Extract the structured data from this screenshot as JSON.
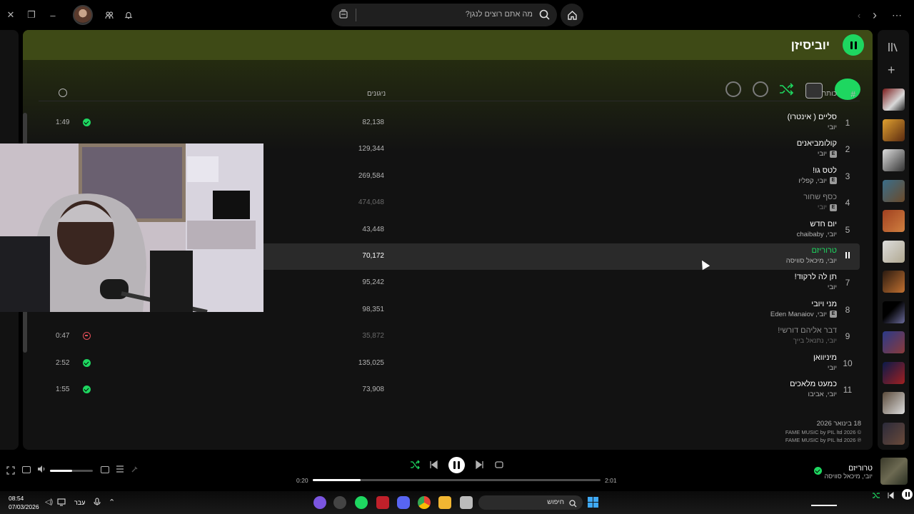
{
  "top": {
    "search_placeholder": "מה אתם רוצים לנגן?"
  },
  "playlist": {
    "title": "יוביסיזן",
    "col_num": "#",
    "col_title": "כותר",
    "col_plays": "ניגונים",
    "release_date": "18 בינואר 2026",
    "copyright_c": "© 2026 FAME MUSIC by PIL ltd",
    "copyright_p": "℗ 2026 FAME MUSIC by PIL ltd",
    "tracks": [
      {
        "num": "1",
        "title": "סליים ( אינטרו)",
        "artist": "יובי",
        "explicit": false,
        "plays": "82,138",
        "duration": "1:49",
        "status": "saved"
      },
      {
        "num": "2",
        "title": "קולומביאנים",
        "artist": "יובי",
        "explicit": true,
        "plays": "129,344",
        "duration": "",
        "status": ""
      },
      {
        "num": "3",
        "title": "לטס גו!",
        "artist": "יובי, קפליו",
        "explicit": true,
        "plays": "269,584",
        "duration": "",
        "status": ""
      },
      {
        "num": "4",
        "title": "כסף שחור",
        "artist": "יובי",
        "explicit": true,
        "plays": "474,048",
        "duration": "",
        "status": ""
      },
      {
        "num": "5",
        "title": "יום חדש",
        "artist": "יובי, chaibaby",
        "explicit": false,
        "plays": "43,448",
        "duration": "",
        "status": ""
      },
      {
        "num": "",
        "title": "טרוריזם",
        "artist": "יובי, מיכאל סוויסה",
        "explicit": false,
        "plays": "70,172",
        "duration": "",
        "status": ""
      },
      {
        "num": "7",
        "title": "תן לה לרקוד!",
        "artist": "יובי",
        "explicit": false,
        "plays": "95,242",
        "duration": "",
        "status": ""
      },
      {
        "num": "8",
        "title": "מני ויובי",
        "artist": "יובי, Eden Manaiov",
        "explicit": true,
        "plays": "98,351",
        "duration": "",
        "status": ""
      },
      {
        "num": "9",
        "title": "דבר אליהם דורשי!",
        "artist": "יובי, נתנאל בייך",
        "explicit": false,
        "plays": "35,872",
        "duration": "0:47",
        "status": "unavailable"
      },
      {
        "num": "10",
        "title": "מיניוואן",
        "artist": "יובי",
        "explicit": false,
        "plays": "135,025",
        "duration": "2:52",
        "status": "saved"
      },
      {
        "num": "11",
        "title": "כמעט מלאכים",
        "artist": "יובי, אביבו",
        "explicit": false,
        "plays": "73,908",
        "duration": "1:55",
        "status": "saved"
      }
    ]
  },
  "player": {
    "track_title": "טרוריזם",
    "track_artist": "יובי, מיכאל סוויסה",
    "elapsed": "0:20",
    "total": "2:01",
    "progress": 0.166,
    "volume": 0.52
  },
  "taskbar": {
    "time": "08:54",
    "date": "07/03/2026",
    "lang": "עבר",
    "search_placeholder": "חיפוש"
  },
  "colors": {
    "accent": "#1ed760",
    "header": "#3e4a16",
    "surface": "#121212"
  }
}
